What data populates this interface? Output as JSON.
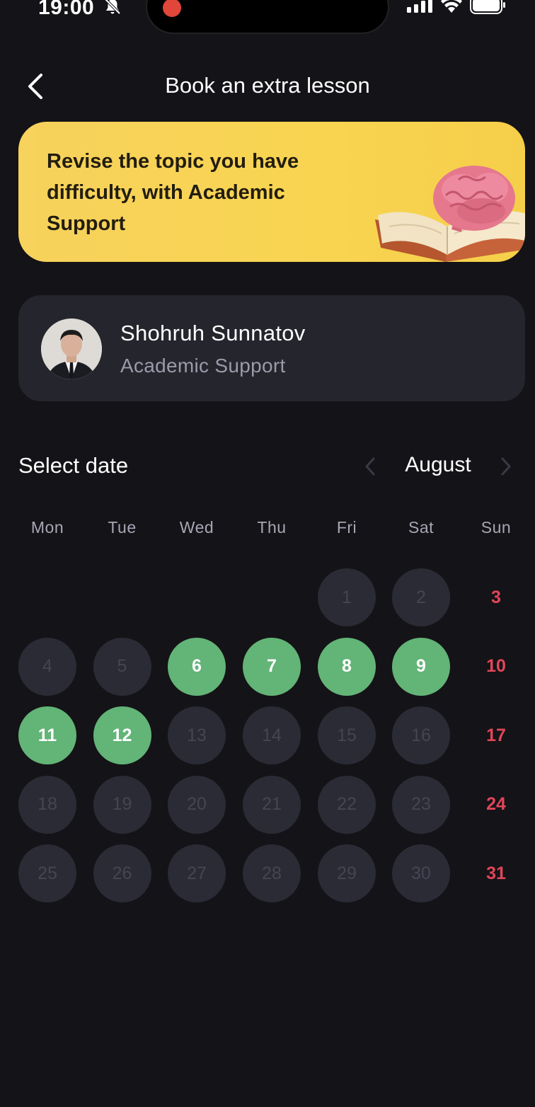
{
  "status_bar": {
    "time": "19:00",
    "icons": [
      "bell-off-icon",
      "recording-dot-icon",
      "cellular-signal-icon",
      "wifi-icon",
      "battery-icon"
    ]
  },
  "header": {
    "back_icon": "chevron-left-icon",
    "title": "Book an extra lesson"
  },
  "banner": {
    "text": "Revise the topic you have difficulty, with Academic Support",
    "image": "brain-on-book-illustration",
    "background_color": "#f8d451"
  },
  "teacher": {
    "name": "Shohruh Sunnatov",
    "role": "Academic Support",
    "avatar": "teacher-photo"
  },
  "calendar": {
    "label": "Select date",
    "month": "August",
    "prev_icon": "chevron-left-icon",
    "next_icon": "chevron-right-icon",
    "weekdays": [
      "Mon",
      "Tue",
      "Wed",
      "Thu",
      "Fri",
      "Sat",
      "Sun"
    ],
    "first_weekday_index": 4,
    "days_in_month": 31,
    "available_days": [
      6,
      7,
      8,
      9,
      11,
      12
    ],
    "colors": {
      "available": "#63b477",
      "unavailable": "#2b2b36",
      "sunday_text": "#e04659",
      "background": "#141317"
    }
  }
}
